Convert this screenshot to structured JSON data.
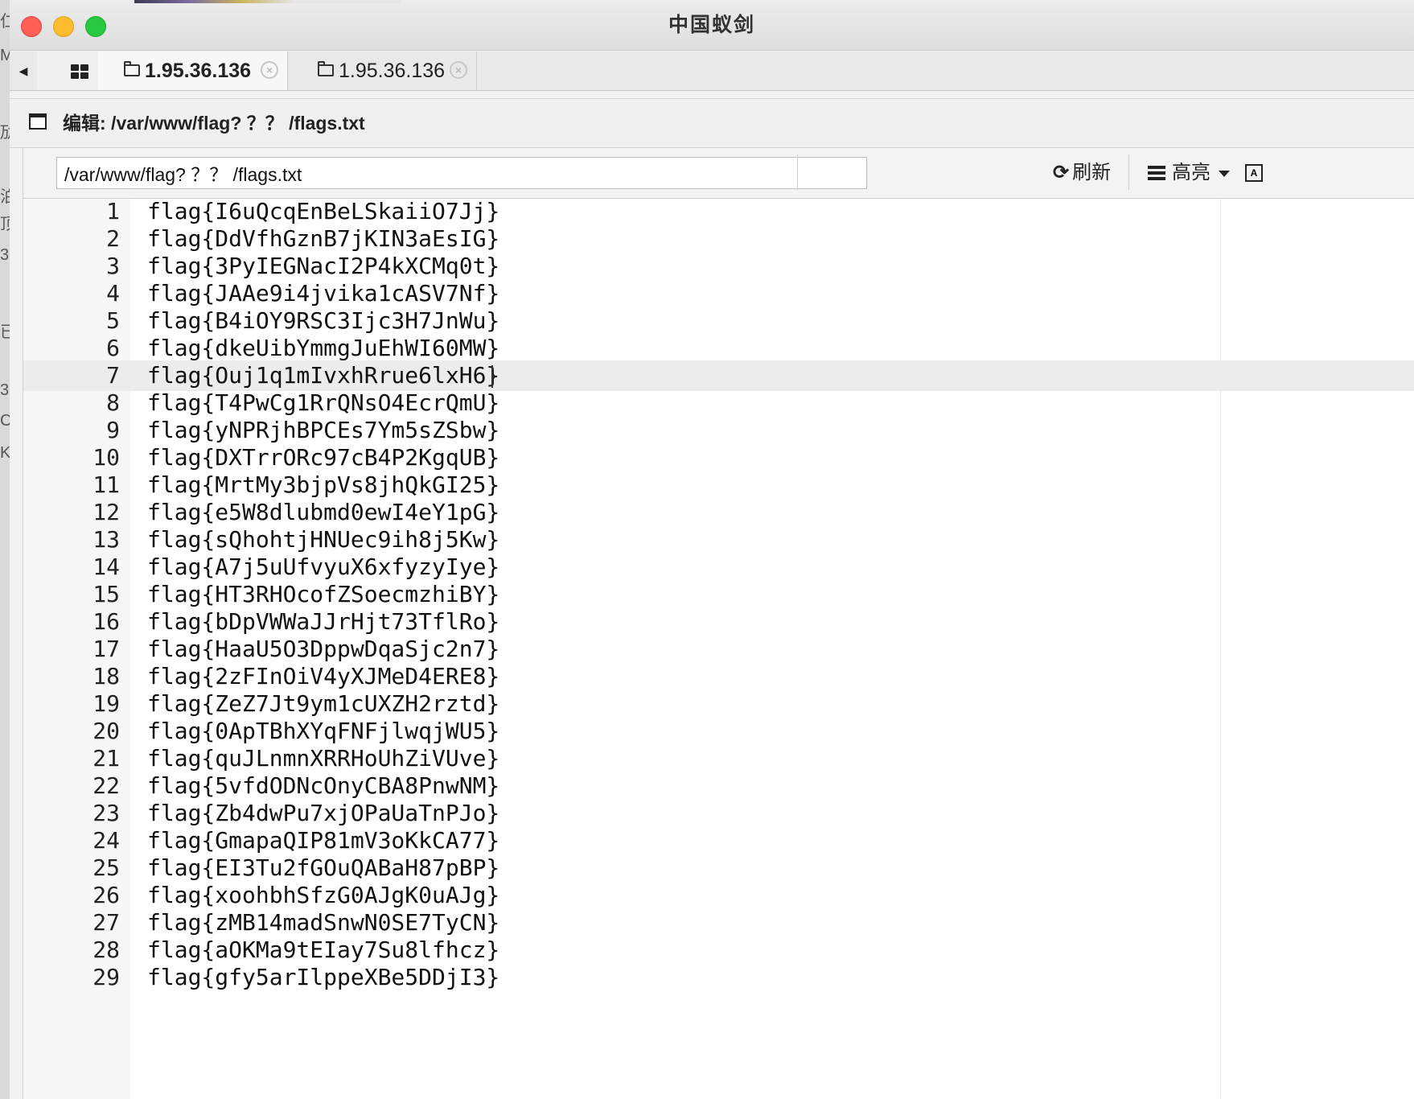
{
  "window": {
    "title": "中国蚁剑"
  },
  "left_strip_fragments": [
    "仁",
    "M",
    "劢",
    "泊",
    "顶",
    "3",
    "已",
    "3",
    "CI",
    "K"
  ],
  "tabs": [
    {
      "label": "1.95.36.136",
      "active": true
    },
    {
      "label": "1.95.36.136",
      "active": false
    }
  ],
  "panel": {
    "title": "编辑: /var/www/flag? ？？ /flags.txt"
  },
  "toolbar": {
    "path_value": "/var/www/flag? ？？ /flags.txt",
    "refresh_label": "刷新",
    "highlight_label": "高亮"
  },
  "editor": {
    "active_line": 7,
    "lines": [
      "flag{I6uQcqEnBeLSkaiiO7Jj}",
      "flag{DdVfhGznB7jKIN3aEsIG}",
      "flag{3PyIEGNacI2P4kXCMq0t}",
      "flag{JAAe9i4jvika1cASV7Nf}",
      "flag{B4iOY9RSC3Ijc3H7JnWu}",
      "flag{dkeUibYmmgJuEhWI60MW}",
      "flag{Ouj1q1mIvxhRrue6lxH6}",
      "flag{T4PwCg1RrQNsO4EcrQmU}",
      "flag{yNPRjhBPCEs7Ym5sZSbw}",
      "flag{DXTrrORc97cB4P2KgqUB}",
      "flag{MrtMy3bjpVs8jhQkGI25}",
      "flag{e5W8dlubmd0ewI4eY1pG}",
      "flag{sQhohtjHNUec9ih8j5Kw}",
      "flag{A7j5uUfvyuX6xfyzyIye}",
      "flag{HT3RHOcofZSoecmzhiBY}",
      "flag{bDpVWWaJJrHjt73TflRo}",
      "flag{HaaU5O3DppwDqaSjc2n7}",
      "flag{2zFInOiV4yXJMeD4ERE8}",
      "flag{ZeZ7Jt9ym1cUXZH2rztd}",
      "flag{0ApTBhXYqFNFjlwqjWU5}",
      "flag{quJLnmnXRRHoUhZiVUve}",
      "flag{5vfdODNcOnyCBA8PnwNM}",
      "flag{Zb4dwPu7xjOPaUaTnPJo}",
      "flag{GmapaQIP81mV3oKkCA77}",
      "flag{EI3Tu2fGOuQABaH87pBP}",
      "flag{xoohbhSfzG0AJgK0uAJg}",
      "flag{zMB14madSnwN0SE7TyCN}",
      "flag{aOKMa9tEIay7Su8lfhcz}",
      "flag{gfy5arIlppeXBe5DDjI3}"
    ]
  }
}
